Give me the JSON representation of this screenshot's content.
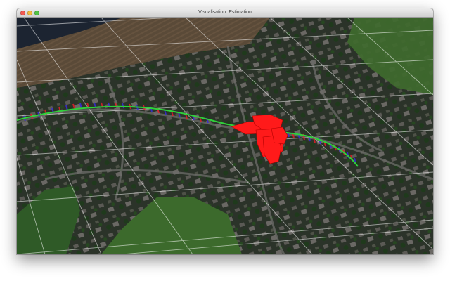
{
  "window": {
    "title": "Visualisation: Estimation"
  },
  "viewport": {
    "description_icon": "3d-map-view",
    "trajectory_color": "#2fd13a",
    "pose_marker_color": "#ff1a1a",
    "pose_marker_alt_color": "#3a2bd6"
  }
}
